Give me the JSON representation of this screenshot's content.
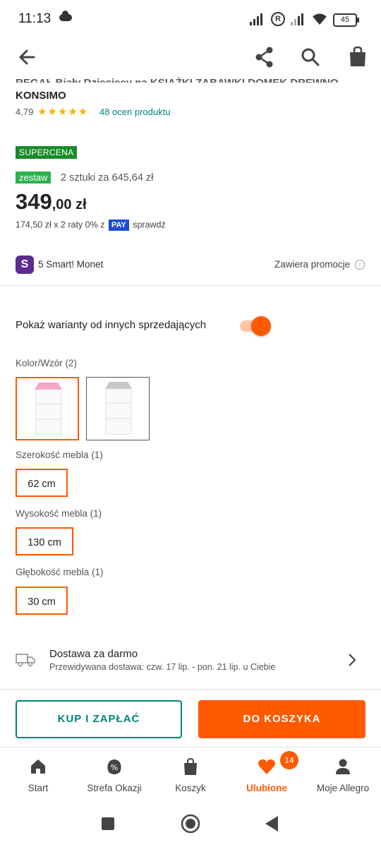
{
  "status": {
    "time": "11:13",
    "battery": "45",
    "r_badge": "R"
  },
  "product": {
    "title": "REGAŁ Biały Dziecięcy na KSIĄŻKI ZABAWKI DOMEK DREWNO PADIS",
    "title_line2": "KONSIMO",
    "rating": "4,79",
    "stars": "★★★★★",
    "reviews": "48 ocen produktu"
  },
  "pricing": {
    "supercena": "SUPERCENA",
    "zestaw_badge": "zestaw",
    "zestaw_text": "2 sztuki za 645,64 zł",
    "price_main": "349",
    "price_rest": ",00 zł",
    "installments_pre": "174,50 zł x 2 raty 0% z",
    "pay_badge": "PAY",
    "installments_post": "sprawdź"
  },
  "smart": {
    "logo": "S",
    "text": "5 Smart! Monet",
    "promo": "Zawiera promocje",
    "info": "i"
  },
  "variants": {
    "toggle_label": "Pokaż warianty od innych sprzedających",
    "toggle_on": true,
    "color_label": "Kolor/Wzór (2)",
    "width_label": "Szerokość mebla (1)",
    "width_value": "62 cm",
    "height_label": "Wysokość mebla (1)",
    "height_value": "130 cm",
    "depth_label": "Głębokość mebla (1)",
    "depth_value": "30 cm"
  },
  "delivery": {
    "title": "Dostawa za darmo",
    "subtitle": "Przewidywana dostawa: czw. 17 lip. - pon. 21 lip. u Ciebie"
  },
  "actions": {
    "buy_now": "KUP I ZAPŁAĆ",
    "add_to_cart": "DO KOSZYKA"
  },
  "tabs": [
    {
      "label": "Start",
      "icon": "home-icon"
    },
    {
      "label": "Strefa Okazji",
      "icon": "percent-bag-icon"
    },
    {
      "label": "Koszyk",
      "icon": "bag-icon"
    },
    {
      "label": "Ulubione",
      "icon": "heart-icon",
      "badge": "14"
    },
    {
      "label": "Moje Allegro",
      "icon": "person-icon"
    }
  ],
  "colors": {
    "accent": "#ff5a00",
    "teal": "#00857c",
    "green": "#1a8a2b"
  }
}
